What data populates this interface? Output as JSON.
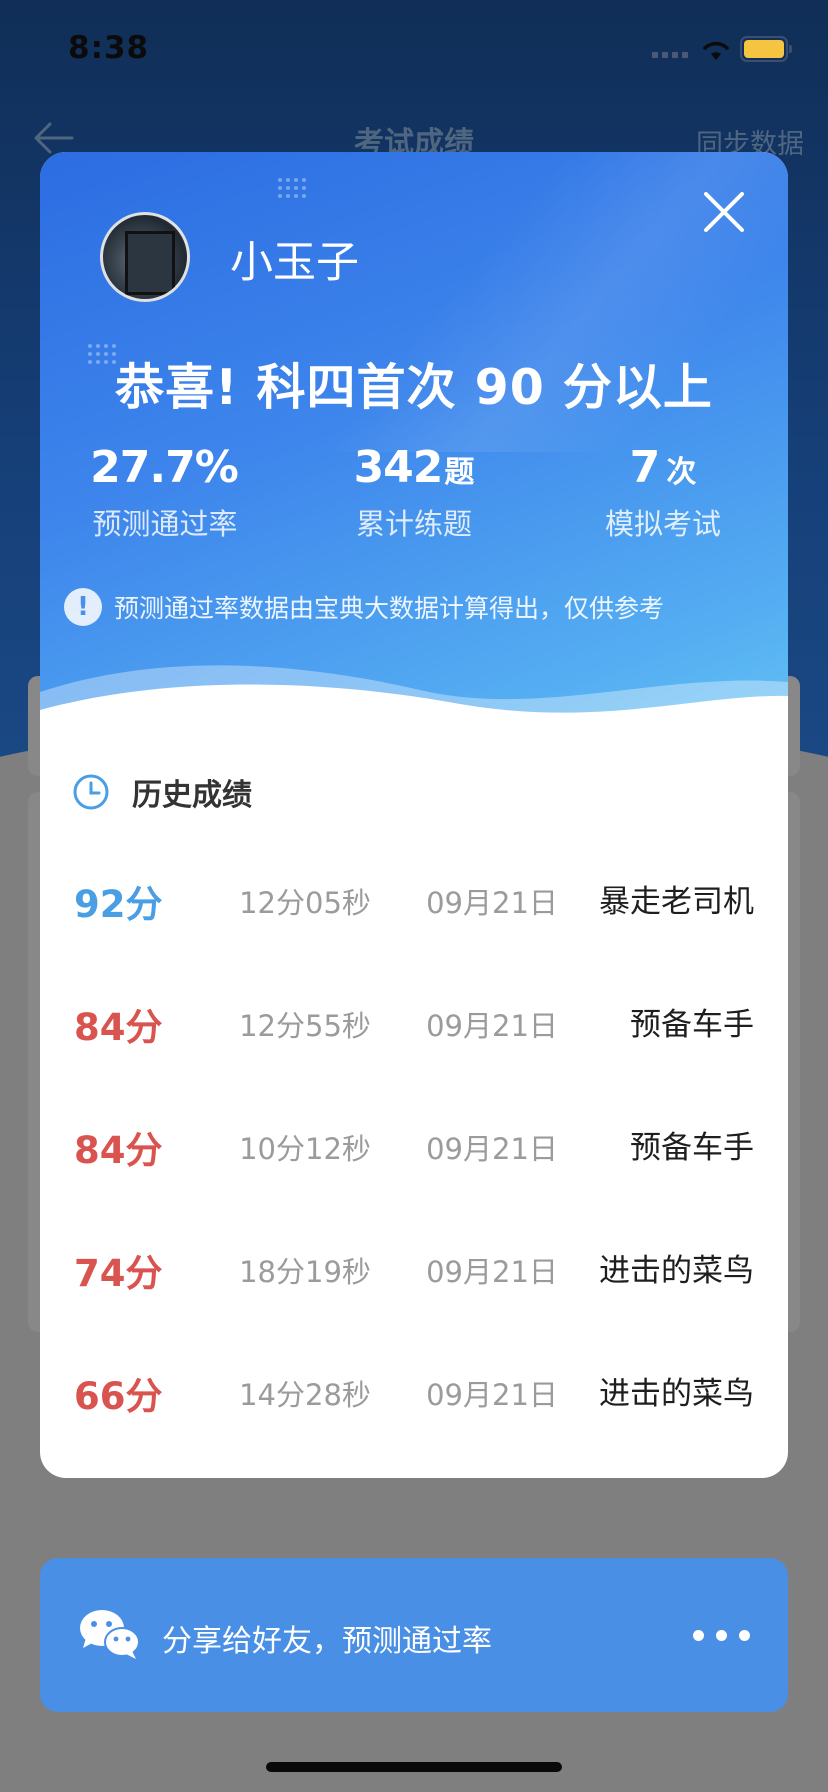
{
  "status_bar": {
    "time": "8:38"
  },
  "nav": {
    "title": "考试成绩",
    "right_action": "同步数据"
  },
  "modal": {
    "username": "小玉子",
    "headline": "恭喜! 科四首次 90 分以上",
    "stats": [
      {
        "value": "27.7%",
        "unit": "",
        "label": "预测通过率"
      },
      {
        "value": "342",
        "unit": "题",
        "label": "累计练题"
      },
      {
        "value": "7",
        "unit": "次",
        "label": "模拟考试"
      }
    ],
    "notice": "预测通过率数据由宝典大数据计算得出，仅供参考",
    "history_title": "历史成绩",
    "history": [
      {
        "score": "92分",
        "duration": "12分05秒",
        "date": "09月21日",
        "rank": "暴走老司机",
        "color": "#4a9ee3"
      },
      {
        "score": "84分",
        "duration": "12分55秒",
        "date": "09月21日",
        "rank": "预备车手",
        "color": "#d9534f"
      },
      {
        "score": "84分",
        "duration": "10分12秒",
        "date": "09月21日",
        "rank": "预备车手",
        "color": "#d9534f"
      },
      {
        "score": "74分",
        "duration": "18分19秒",
        "date": "09月21日",
        "rank": "进击的菜鸟",
        "color": "#d9534f"
      },
      {
        "score": "66分",
        "duration": "14分28秒",
        "date": "09月21日",
        "rank": "进击的菜鸟",
        "color": "#d9534f"
      }
    ]
  },
  "share": {
    "text": "分享给好友，预测通过率"
  },
  "icons": {
    "back": "arrow-left-icon",
    "close": "close-icon",
    "info": "info-icon",
    "clock": "clock-icon",
    "wechat": "wechat-icon",
    "more": "more-dots-icon"
  },
  "colors": {
    "accent": "#3e86ec",
    "pass_score": "#4a9ee3",
    "fail_score": "#d9534f",
    "share_bar": "#4a8fe6"
  }
}
